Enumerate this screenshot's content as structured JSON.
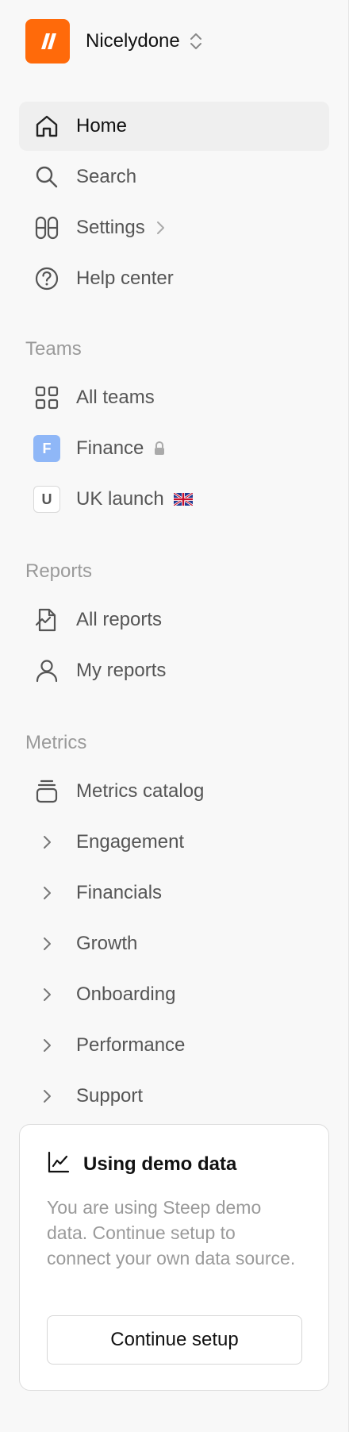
{
  "workspace": {
    "name": "Nicelydone",
    "logo_color": "#ff6a0a"
  },
  "nav": {
    "home": "Home",
    "search": "Search",
    "settings": "Settings",
    "help": "Help center"
  },
  "teams": {
    "header": "Teams",
    "all": "All teams",
    "finance": {
      "label": "Finance",
      "badge": "F",
      "badge_color": "#8fb7f7"
    },
    "uk": {
      "label": "UK launch",
      "badge": "U"
    }
  },
  "reports": {
    "header": "Reports",
    "all": "All reports",
    "mine": "My reports"
  },
  "metrics": {
    "header": "Metrics",
    "catalog": "Metrics catalog",
    "groups": [
      "Engagement",
      "Financials",
      "Growth",
      "Onboarding",
      "Performance",
      "Support"
    ]
  },
  "demo_card": {
    "title": "Using demo data",
    "text": "You are using Steep demo data. Continue setup to connect your own data source.",
    "button": "Continue setup"
  },
  "icons": {
    "home": "home-icon",
    "search": "search-icon",
    "settings": "settings-toggle-icon",
    "help": "help-circle-icon",
    "all_teams": "grid-icon",
    "lock": "lock-icon",
    "flag": "uk-flag-icon",
    "all_reports": "report-icon",
    "my_reports": "user-icon",
    "catalog": "stack-icon",
    "chevron": "chevron-right-icon",
    "chart": "line-chart-icon"
  }
}
